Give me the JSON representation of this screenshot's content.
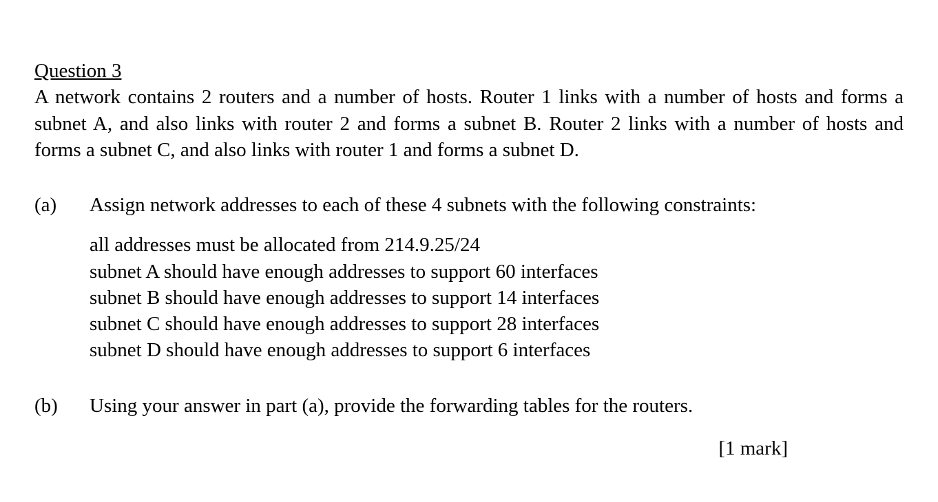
{
  "question": {
    "title": "Question 3",
    "body": "A network contains 2 routers and a number of hosts. Router 1 links with a number of hosts and forms a subnet A, and also links with router 2 and forms a subnet B. Router 2 links with a number of hosts and forms a subnet C, and also links with router 1 and forms a subnet D."
  },
  "partA": {
    "label": "(a)",
    "prompt": "Assign network addresses to each of these 4 subnets with the following constraints:",
    "constraints": [
      "all addresses must be allocated from 214.9.25/24",
      "subnet A should have enough addresses to support 60 interfaces",
      "subnet B should have enough addresses to support 14 interfaces",
      "subnet C should have enough addresses to support 28 interfaces",
      "subnet D should have enough addresses to support 6 interfaces"
    ]
  },
  "partB": {
    "label": "(b)",
    "prompt": "Using your answer in part (a), provide the forwarding tables for the routers."
  },
  "marks": "[1 mark]"
}
